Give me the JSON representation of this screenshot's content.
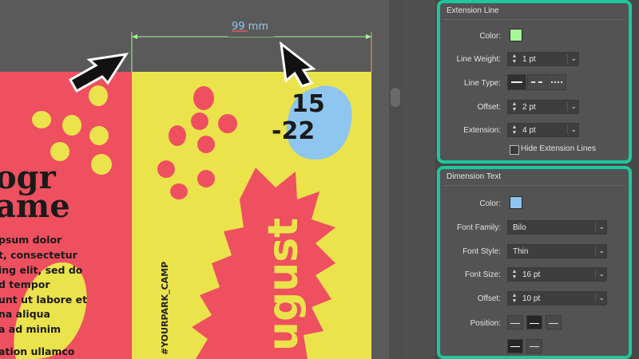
{
  "canvas": {
    "dimension_label": "99 mm",
    "date_line1": "15",
    "date_line2": "-22",
    "title_line1": "ogr",
    "title_line2": "ame",
    "body_text": [
      "psum dolor",
      "t, consectetur",
      "ing elit, sed do",
      "d tempor",
      "unt ut labore et",
      "na aliqua",
      "a ad minim",
      "ation ullamco"
    ],
    "vertical_tag": "#YOURPARK_CAMP",
    "month_text": "ugust"
  },
  "extension_line": {
    "title": "Extension Line",
    "color_label": "Color:",
    "color": "#a6f79a",
    "line_weight_label": "Line Weight:",
    "line_weight": "1 pt",
    "line_type_label": "Line Type:",
    "offset_label": "Offset:",
    "offset": "2 pt",
    "extension_label": "Extension:",
    "extension": "4 pt",
    "hide_label": "Hide Extension Lines"
  },
  "dimension_text": {
    "title": "Dimension Text",
    "color_label": "Color:",
    "color": "#8ec6ef",
    "font_family_label": "Font Family:",
    "font_family": "Bilo",
    "font_style_label": "Font Style:",
    "font_style": "Thin",
    "font_size_label": "Font Size:",
    "font_size": "16 pt",
    "offset_label": "Offset:",
    "offset": "10 pt",
    "position_label": "Position:"
  },
  "colors": {
    "accent": "#1ec79b",
    "poster_red": "#ee5060",
    "poster_yellow": "#ebe34c",
    "poster_blue": "#8ec6ef"
  }
}
